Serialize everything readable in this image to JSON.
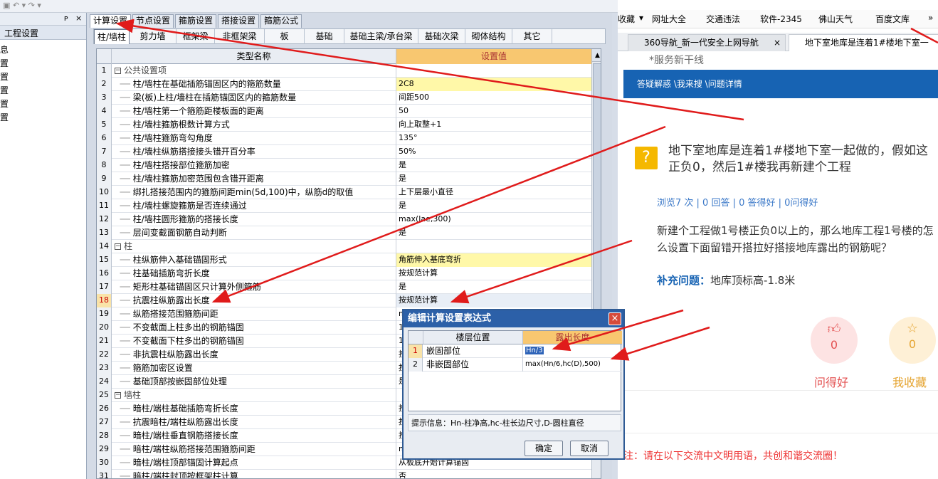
{
  "window": {
    "toolbar_glyphs": "▣  ↶ ▾  ↷ ▾"
  },
  "tree": {
    "header_pin": "ᴘ",
    "header_close": "×",
    "title": "工程设置",
    "items": [
      "息",
      "置",
      "置",
      "置",
      "置",
      "置"
    ]
  },
  "tabs_top": [
    "计算设置",
    "节点设置",
    "箍筋设置",
    "搭接设置",
    "箍筋公式"
  ],
  "tabs_sub": [
    "柱/墙柱",
    "剪力墙",
    "框架梁",
    "非框架梁",
    "板",
    "基础",
    "基础主梁/承台梁",
    "基础次梁",
    "砌体结构",
    "其它"
  ],
  "grid": {
    "headers": {
      "name": "类型名称",
      "value": "设置值"
    },
    "rows": [
      {
        "n": "1",
        "name": "公共设置项",
        "value": "",
        "group": true
      },
      {
        "n": "2",
        "name": "柱/墙柱在基础插筋锚固区内的箍筋数量",
        "value": "2C8",
        "yel": true
      },
      {
        "n": "3",
        "name": "梁(板)上柱/墙柱在插筋锚固区内的箍筋数量",
        "value": "间距500"
      },
      {
        "n": "4",
        "name": "柱/墙柱第一个箍筋距楼板面的距离",
        "value": "50"
      },
      {
        "n": "5",
        "name": "柱/墙柱箍筋根数计算方式",
        "value": "向上取整+1"
      },
      {
        "n": "6",
        "name": "柱/墙柱箍筋弯勾角度",
        "value": "135°"
      },
      {
        "n": "7",
        "name": "柱/墙柱纵筋搭接接头错开百分率",
        "value": "50%"
      },
      {
        "n": "8",
        "name": "柱/墙柱搭接部位箍筋加密",
        "value": "是"
      },
      {
        "n": "9",
        "name": "柱/墙柱箍筋加密范围包含错开距离",
        "value": "是"
      },
      {
        "n": "10",
        "name": "绑扎搭接范围内的箍筋间距min(5d,100)中，纵筋d的取值",
        "value": "上下层最小直径"
      },
      {
        "n": "11",
        "name": "柱/墙柱螺旋箍筋是否连续通过",
        "value": "是"
      },
      {
        "n": "12",
        "name": "柱/墙柱圆形箍筋的搭接长度",
        "value": "max(lae,300)"
      },
      {
        "n": "13",
        "name": "层间变截面钢筋自动判断",
        "value": "是"
      },
      {
        "n": "14",
        "name": "柱",
        "value": "",
        "group": true
      },
      {
        "n": "15",
        "name": "柱纵筋伸入基础锚固形式",
        "value": "角筋伸入基底弯折",
        "yel": true
      },
      {
        "n": "16",
        "name": "柱基础插筋弯折长度",
        "value": "按规范计算"
      },
      {
        "n": "17",
        "name": "矩形柱基础锚固区只计算外侧箍筋",
        "value": "是"
      },
      {
        "n": "18",
        "name": "抗震柱纵筋露出长度",
        "value": "按规范计算",
        "act": true
      },
      {
        "n": "19",
        "name": "纵筋搭接范围箍筋间距",
        "value": "m"
      },
      {
        "n": "20",
        "name": "不变截面上柱多出的钢筋锚固",
        "value": "1"
      },
      {
        "n": "21",
        "name": "不变截面下柱多出的钢筋锚固",
        "value": "1"
      },
      {
        "n": "22",
        "name": "非抗震柱纵筋露出长度",
        "value": "按"
      },
      {
        "n": "23",
        "name": "箍筋加密区设置",
        "value": "按"
      },
      {
        "n": "24",
        "name": "基础顶部按嵌固部位处理",
        "value": "是"
      },
      {
        "n": "25",
        "name": "墙柱",
        "value": "",
        "group": true
      },
      {
        "n": "26",
        "name": "暗柱/端柱基础插筋弯折长度",
        "value": "按"
      },
      {
        "n": "27",
        "name": "抗震暗柱/端柱纵筋露出长度",
        "value": "按"
      },
      {
        "n": "28",
        "name": "暗柱/端柱垂直钢筋搭接长度",
        "value": "按"
      },
      {
        "n": "29",
        "name": "暗柱/端柱纵筋搭接范围箍筋间距",
        "value": "m"
      },
      {
        "n": "30",
        "name": "暗柱/端柱顶部锚固计算起点",
        "value": "从板底开始计算锚固"
      },
      {
        "n": "31",
        "name": "暗柱/端柱封顶按框架柱计算",
        "value": "否"
      }
    ]
  },
  "dialog": {
    "title": "编辑计算设置表达式",
    "close": "×",
    "col_floor": "楼层位置",
    "col_len": "露出长度",
    "rows": [
      {
        "n": "1",
        "pos": "嵌固部位",
        "expr": "Hn/3"
      },
      {
        "n": "2",
        "pos": "非嵌固部位",
        "expr": "max(Hn/6,hc(D),500)"
      }
    ],
    "hint": "提示信息：Hn-柱净高,hc-柱长边尺寸,D-圆柱直径",
    "ok": "确定",
    "cancel": "取消"
  },
  "browser": {
    "bookmarks": [
      "收藏",
      "▾",
      "网址大全",
      "交通违法",
      "软件-2345",
      "佛山天气",
      "百度文库",
      "»"
    ],
    "tabs": [
      "360导航_新一代安全上网导航",
      "地下室地库是连着1#楼地下室一"
    ],
    "tab_close": "×",
    "banner_top": "*服务新干线",
    "breadcrumb": "答疑解惑 \\我来搜 \\问题详情",
    "question_title": "地下室地库是连着1#楼地下室一起做的，假如这正负0，然后1#楼我再新建个工程",
    "stats": "浏览7 次 | 0 回答 | 0 答得好 | 0问得好",
    "body": "新建个工程做1号楼正负0以上的，那么地库工程1号楼的怎么设置下面留错开搭拉好搭接地库露出的钢筋呢？",
    "supp_label": "补充问题：",
    "supp_text": "地库顶标高-1.8米",
    "like_count": "0",
    "fav_count": "0",
    "like_label": "问得好",
    "fav_label": "我收藏",
    "notice": "注：请在以下交流中文明用语，共创和谐交流圈！"
  }
}
